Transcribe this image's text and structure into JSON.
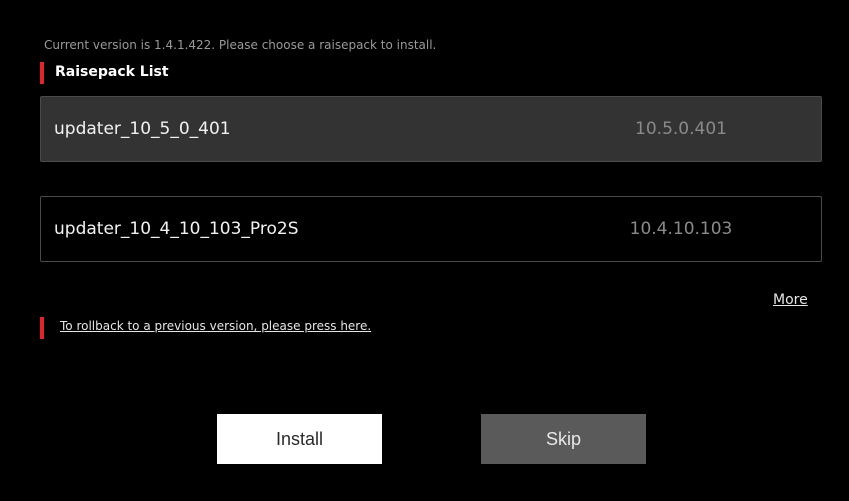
{
  "header": {
    "version_text": "Current version is 1.4.1.422. Please choose a raisepack to install.",
    "section_title": "Raisepack List"
  },
  "raisepacks": [
    {
      "name": "updater_10_5_0_401",
      "version": "10.5.0.401",
      "selected": true
    },
    {
      "name": "updater_10_4_10_103_Pro2S",
      "version": "10.4.10.103",
      "selected": false
    }
  ],
  "links": {
    "more": "More",
    "rollback": "To rollback to a previous version, please press here."
  },
  "buttons": {
    "install": "Install",
    "skip": "Skip"
  },
  "colors": {
    "background": "#000000",
    "accent": "#e0262a",
    "selected_item": "#333333",
    "install_button": "#ffffff",
    "skip_button": "#5a5a5a"
  }
}
